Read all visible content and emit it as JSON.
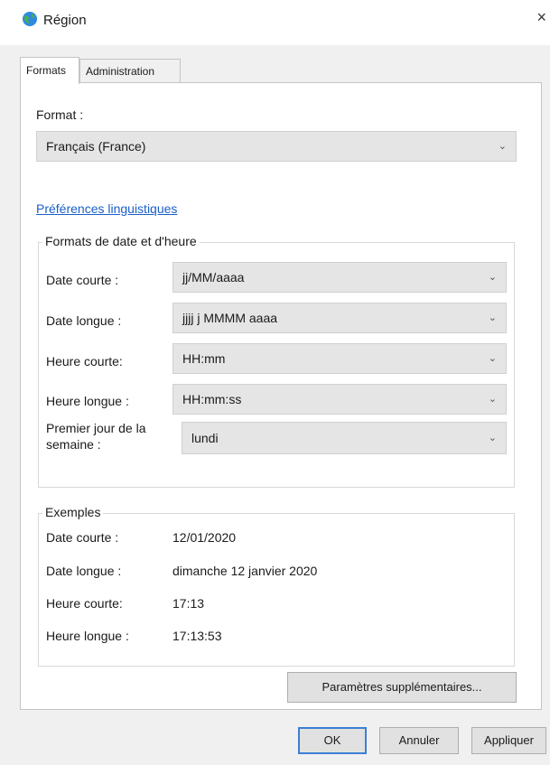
{
  "window": {
    "title": "Région",
    "close_glyph": "×",
    "icon": "globe-icon"
  },
  "tabs": [
    {
      "label": "Formats",
      "active": true
    },
    {
      "label": "Administration",
      "active": false
    }
  ],
  "format": {
    "label": "Format :",
    "value": "Français (France)",
    "link": "Préférences linguistiques"
  },
  "date_time_formats": {
    "group_title": "Formats de date et d'heure",
    "rows": [
      {
        "label": "Date courte :",
        "value": "jj/MM/aaaa"
      },
      {
        "label": "Date longue :",
        "value": "jjjj j MMMM aaaa"
      },
      {
        "label": "Heure courte:",
        "value": "HH:mm"
      },
      {
        "label": "Heure longue :",
        "value": "HH:mm:ss"
      },
      {
        "label": "Premier jour de la semaine :",
        "value": "lundi"
      }
    ]
  },
  "examples": {
    "group_title": "Exemples",
    "rows": [
      {
        "label": "Date courte :",
        "value": "12/01/2020"
      },
      {
        "label": "Date longue :",
        "value": "dimanche 12 janvier 2020"
      },
      {
        "label": "Heure courte:",
        "value": "17:13"
      },
      {
        "label": "Heure longue :",
        "value": "17:13:53"
      }
    ]
  },
  "buttons": {
    "additional_settings": "Paramètres supplémentaires...",
    "ok": "OK",
    "cancel": "Annuler",
    "apply": "Appliquer"
  },
  "colors": {
    "accent": "#3b7fd6",
    "link": "#1a5fc9",
    "combo_bg": "#e5e5e5"
  }
}
